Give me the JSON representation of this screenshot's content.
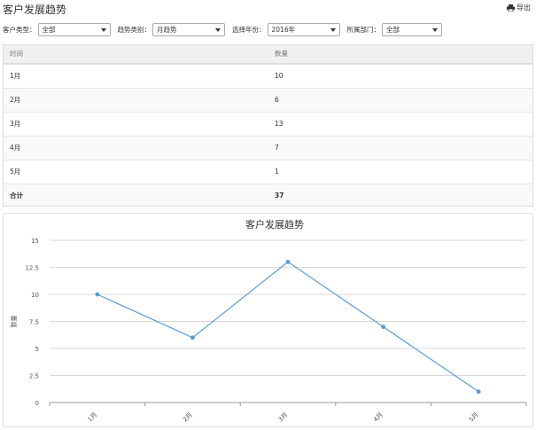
{
  "header": {
    "title": "客户发展趋势",
    "export_label": "导出"
  },
  "filters": [
    {
      "label": "客户类型：",
      "value": "全部"
    },
    {
      "label": "趋势类别：",
      "value": "月趋势"
    },
    {
      "label": "选择年份：",
      "value": "2016年"
    },
    {
      "label": "所属部门：",
      "value": "全部"
    }
  ],
  "table": {
    "columns": [
      "时间",
      "数量"
    ],
    "rows": [
      [
        "1月",
        "10"
      ],
      [
        "2月",
        "6"
      ],
      [
        "3月",
        "13"
      ],
      [
        "4月",
        "7"
      ],
      [
        "5月",
        "1"
      ]
    ],
    "total": [
      "合计",
      "37"
    ]
  },
  "chart_data": {
    "type": "line",
    "title": "客户发展趋势",
    "xlabel": "",
    "ylabel": "数量",
    "categories": [
      "1月",
      "2月",
      "3月",
      "4月",
      "5月"
    ],
    "series": [
      {
        "values": [
          10,
          6,
          13,
          7,
          1
        ]
      }
    ],
    "ylim": [
      0,
      15
    ],
    "yticks": [
      "0",
      "2.5",
      "5",
      "7.5",
      "10",
      "12.5",
      "15"
    ],
    "grid": true,
    "line_color": "#5b9bd5"
  }
}
